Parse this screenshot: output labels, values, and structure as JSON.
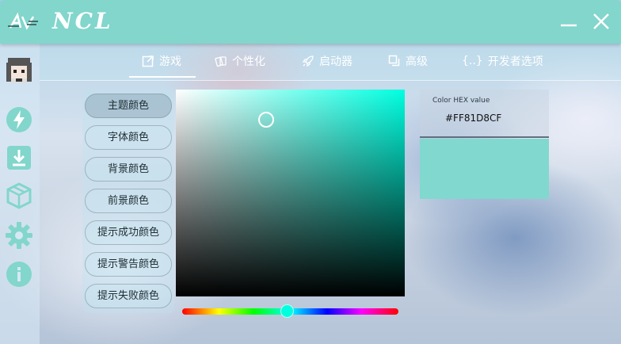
{
  "app": {
    "title": "NCL",
    "accent": "#82d6cc"
  },
  "window": {
    "minimize_icon": "minimize-icon",
    "close_icon": "close-icon"
  },
  "sidebar": {
    "items": [
      {
        "name": "avatar"
      },
      {
        "name": "lightning-icon"
      },
      {
        "name": "download-icon"
      },
      {
        "name": "package-icon"
      },
      {
        "name": "gear-icon"
      },
      {
        "name": "info-icon"
      }
    ]
  },
  "tabs": [
    {
      "label": "游戏",
      "icon": "external-link-icon",
      "active": true
    },
    {
      "label": "个性化",
      "icon": "cards-icon"
    },
    {
      "label": "启动器",
      "icon": "rocket-icon"
    },
    {
      "label": "高级",
      "icon": "layers-icon"
    },
    {
      "label": "开发者选项",
      "icon": "braces-icon"
    }
  ],
  "color_buttons": [
    {
      "label": "主题颜色",
      "active": true
    },
    {
      "label": "字体颜色"
    },
    {
      "label": "背景颜色"
    },
    {
      "label": "前景颜色"
    },
    {
      "label": "提示成功颜色"
    },
    {
      "label": "提示警告颜色"
    },
    {
      "label": "提示失败颜色"
    }
  ],
  "color_picker": {
    "hex_label": "Color HEX value",
    "hex_value": "#FF81D8CF",
    "hue_color": "#00ffe1",
    "preview_color": "#81d8cf"
  }
}
